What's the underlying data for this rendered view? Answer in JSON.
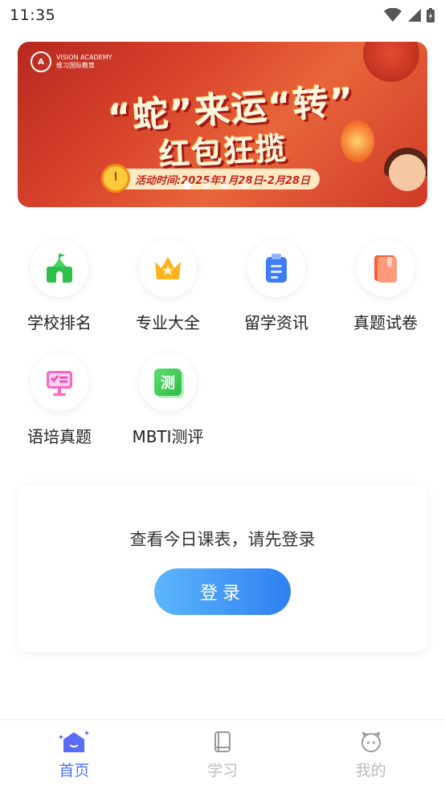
{
  "status_bar": {
    "time": "11:35"
  },
  "banner": {
    "logo_en": "VISION ACADEMY",
    "logo_cn": "维习国际教育",
    "title_line1": "“蛇”来运“转”",
    "title_line2": "红包狂揽",
    "date_text": "活动时间:2025年1月28日-2月28日",
    "page_count": 4,
    "active_page": 1
  },
  "grid": {
    "items": [
      {
        "label": "学校排名",
        "icon": "school-icon"
      },
      {
        "label": "专业大全",
        "icon": "crown-icon"
      },
      {
        "label": "留学资讯",
        "icon": "clipboard-icon"
      },
      {
        "label": "真题试卷",
        "icon": "book-icon"
      },
      {
        "label": "语培真题",
        "icon": "whiteboard-icon"
      },
      {
        "label": "MBTI测评",
        "icon": "test-icon",
        "icon_text": "测"
      }
    ]
  },
  "schedule_card": {
    "message": "查看今日课表，请先登录",
    "login_label": "登录"
  },
  "tabbar": {
    "tabs": [
      {
        "label": "首页",
        "icon": "home-icon",
        "active": true
      },
      {
        "label": "学习",
        "icon": "book-icon",
        "active": false
      },
      {
        "label": "我的",
        "icon": "profile-icon",
        "active": false
      }
    ]
  },
  "colors": {
    "accent": "#4a72f5",
    "login_gradient_start": "#5cb6fb",
    "login_gradient_end": "#2f80f2",
    "tab_inactive": "#bbbbbb"
  }
}
